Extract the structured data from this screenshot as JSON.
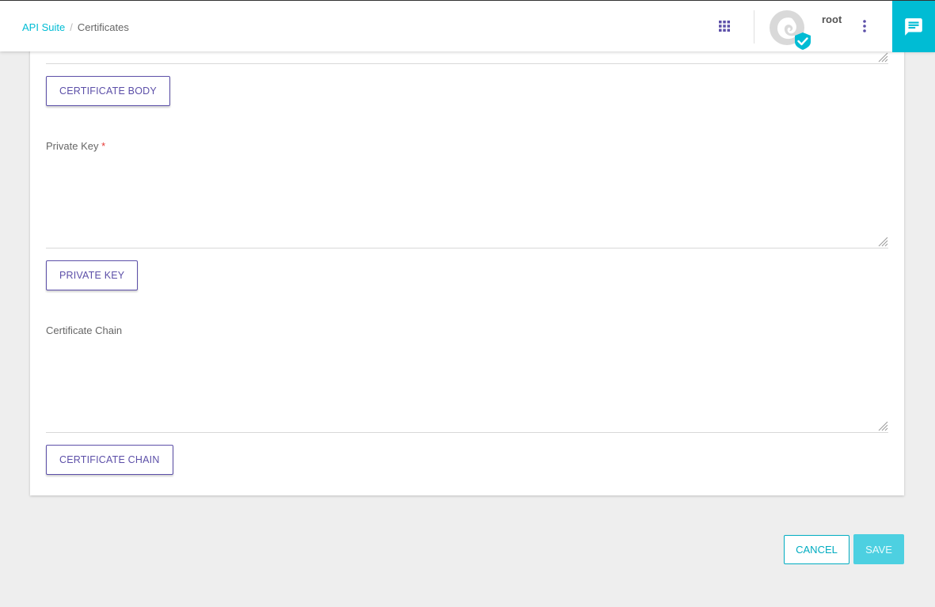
{
  "header": {
    "breadcrumb": {
      "root": "API Suite",
      "separator": "/",
      "current": "Certificates"
    },
    "user": {
      "name": "root"
    },
    "icons": {
      "apps": "apps-grid-icon",
      "avatar": "avatar-verified-icon",
      "menu": "kebab-menu-icon",
      "chat": "chat-icon"
    }
  },
  "form": {
    "certificate_body": {
      "button_label": "CERTIFICATE BODY"
    },
    "private_key": {
      "label": "Private Key",
      "required_mark": "*",
      "value": "",
      "button_label": "PRIVATE KEY"
    },
    "certificate_chain": {
      "label": "Certificate Chain",
      "value": "",
      "button_label": "CERTIFICATE CHAIN"
    }
  },
  "actions": {
    "cancel_label": "CANCEL",
    "save_label": "SAVE"
  },
  "colors": {
    "accent": "#00bcd4",
    "primary_purple": "#5c4fa8",
    "required": "#e53935",
    "save_disabled": "#4dd0e1",
    "page_background": "#eeeeee"
  }
}
